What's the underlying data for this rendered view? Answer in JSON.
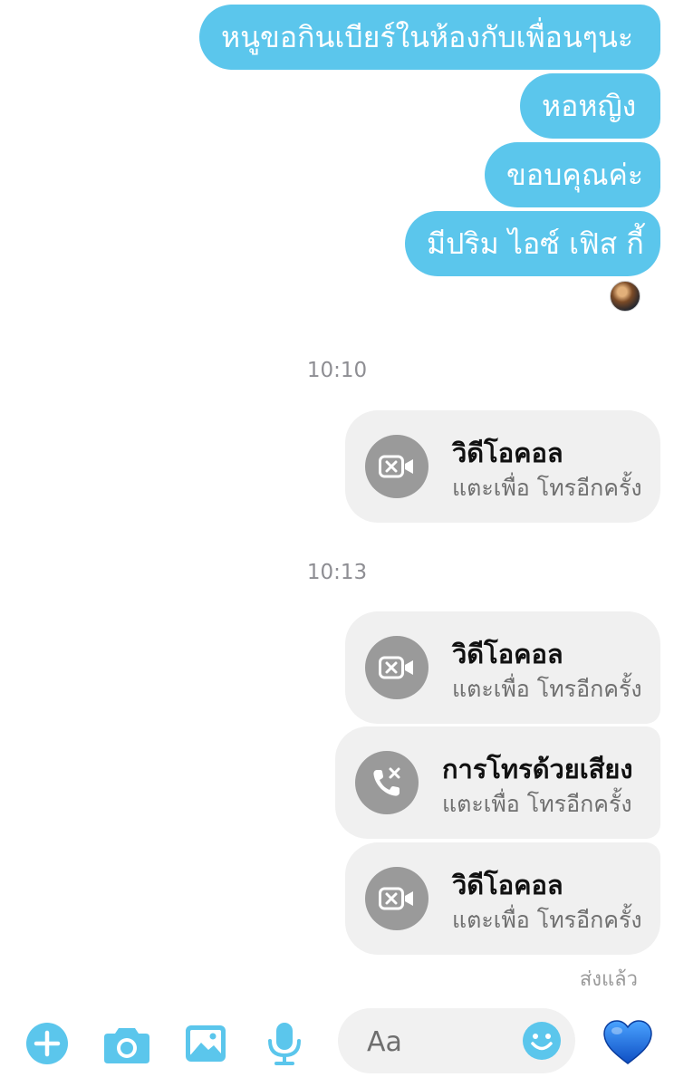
{
  "messages": [
    {
      "text": "หนูขอกินเบียร์ในห้องกับเพื่อนๆนะ"
    },
    {
      "text": "หอหญิง"
    },
    {
      "text": "ขอบคุณค่ะ"
    },
    {
      "text": "มีปริม ไอซ์ เฟิส กี้"
    }
  ],
  "timestamps": [
    "10:10",
    "10:13"
  ],
  "calls": [
    {
      "type": "video",
      "title": "วิดีโอคอล",
      "subtitle": "แตะเพื่อ โทรอีกครั้ง"
    },
    {
      "type": "video",
      "title": "วิดีโอคอล",
      "subtitle": "แตะเพื่อ โทรอีกครั้ง"
    },
    {
      "type": "voice",
      "title": "การโทรด้วยเสียง",
      "subtitle": "แตะเพื่อ โทรอีกครั้ง"
    },
    {
      "type": "video",
      "title": "วิดีโอคอล",
      "subtitle": "แตะเพื่อ โทรอีกครั้ง"
    }
  ],
  "sent_status": "ส่งแล้ว",
  "composer": {
    "placeholder": "Aa"
  },
  "colors": {
    "accent": "#5bc6ec",
    "bubble_text": "#ffffff",
    "call_card": "#f0f0f0",
    "call_icon": "#9a9a9a",
    "like_heart": "#1e6fe0"
  },
  "toolbar_icons": [
    "plus-icon",
    "camera-icon",
    "image-icon",
    "microphone-icon",
    "emoji-icon",
    "heart-icon"
  ]
}
